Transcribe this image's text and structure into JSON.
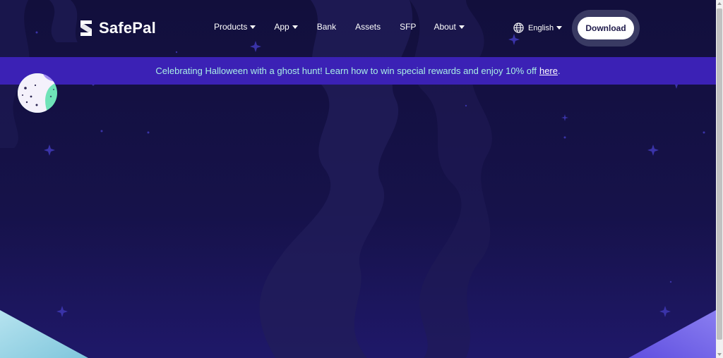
{
  "brand": {
    "name": "SafePal",
    "logo_icon": "safepal-logo-icon"
  },
  "nav": {
    "items": [
      {
        "label": "Products",
        "has_dropdown": true
      },
      {
        "label": "App",
        "has_dropdown": true
      },
      {
        "label": "Bank",
        "has_dropdown": false
      },
      {
        "label": "Assets",
        "has_dropdown": false
      },
      {
        "label": "SFP",
        "has_dropdown": false
      },
      {
        "label": "About",
        "has_dropdown": true
      }
    ]
  },
  "language": {
    "label": "English",
    "icon": "globe-icon"
  },
  "download": {
    "label": "Download"
  },
  "banner": {
    "text": "Celebrating Halloween with a ghost hunt! Learn how to win special rewards and enjoy 10% off",
    "link_label": "here",
    "suffix": "."
  },
  "colors": {
    "background": "#120f3c",
    "banner": "#3b21b5",
    "banner_text": "#a9efe5",
    "accent_green": "#6fe3b8",
    "accent_purple": "#a28bf5"
  }
}
